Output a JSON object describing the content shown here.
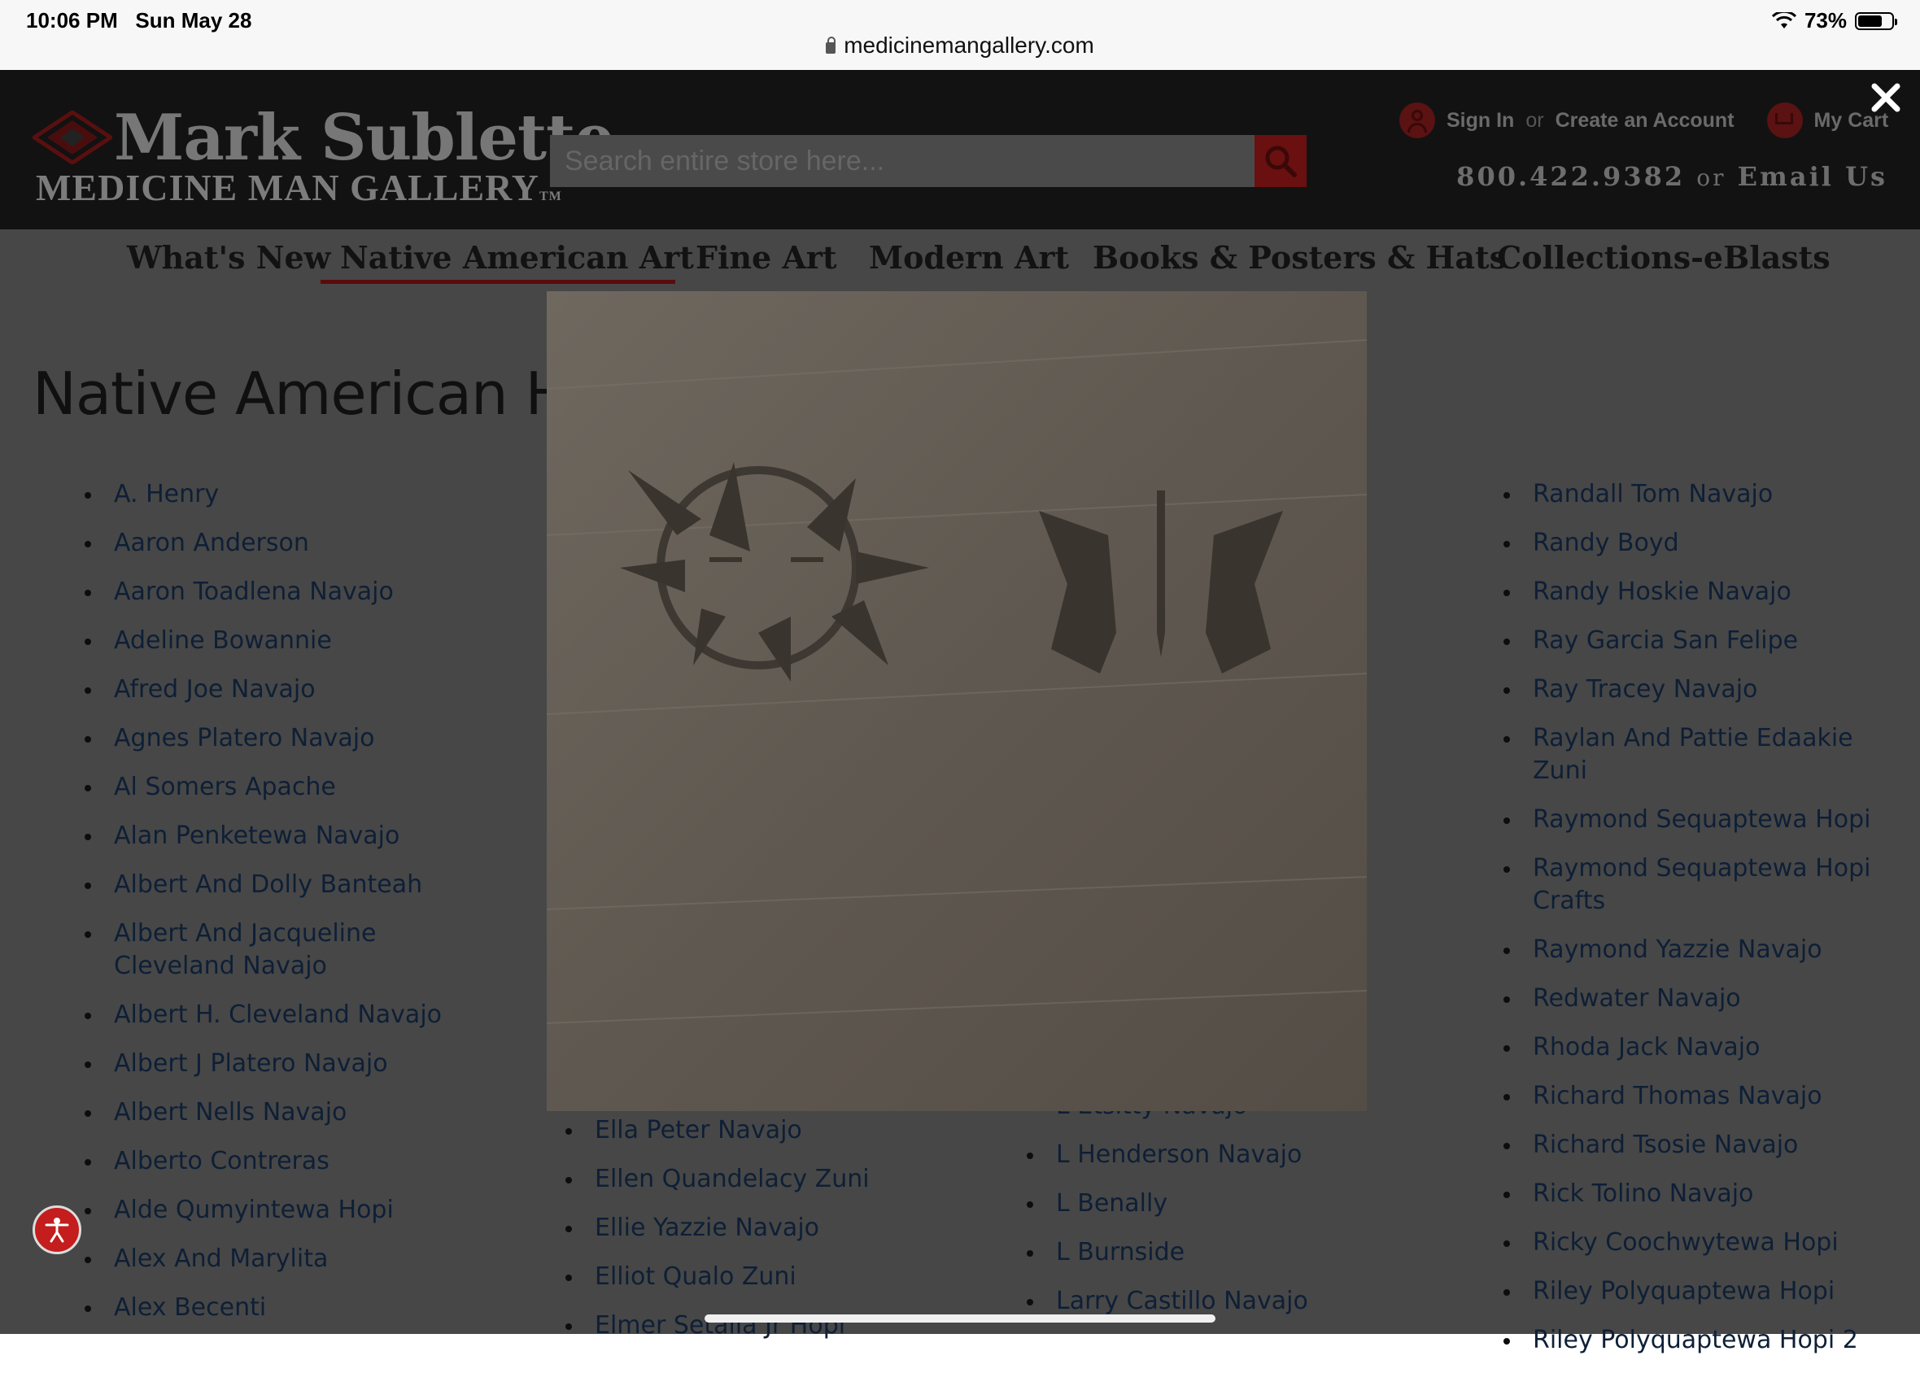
{
  "status_bar": {
    "time": "10:06 PM",
    "date": "Sun May 28",
    "battery": "73%",
    "battery_level": 0.73,
    "url": "medicinemangallery.com"
  },
  "header": {
    "logo_line1": "Mark Sublette",
    "logo_line2": "MEDICINE MAN GALLERY",
    "logo_tm": "TM",
    "search_placeholder": "Search entire store here...",
    "sign_in": "Sign In",
    "or": "or",
    "create_account": "Create an Account",
    "my_cart": "My Cart",
    "phone": "800.422.9382",
    "email": "Email Us"
  },
  "nav": {
    "items": [
      "What's New",
      "Native American Art",
      "Fine Art",
      "Modern Art",
      "Books & Posters & Hats",
      "Collections-eBlasts"
    ],
    "active": "Native American Art"
  },
  "page": {
    "title": "Native American Ha",
    "col1": [
      "A. Henry",
      "Aaron Anderson",
      "Aaron Toadlena Navajo",
      "Adeline Bowannie",
      "Afred Joe Navajo",
      "Agnes Platero Navajo",
      "Al Somers Apache",
      "Alan Penketewa Navajo",
      "Albert And Dolly Banteah",
      "Albert And Jacqueline Cleveland Navajo",
      "Albert H. Cleveland Navajo",
      "Albert J Platero Navajo",
      "Albert Nells Navajo",
      "Alberto Contreras",
      "Alde Qumyintewa Hopi",
      "Alex And Marylita",
      "Alex Becenti"
    ],
    "col2": [
      "Ella Peter Navajo",
      "Ellen Quandelacy Zuni",
      "Ellie Yazzie Navajo",
      "Elliot Qualo Zuni",
      "Elmer Setalla Jr Hopi"
    ],
    "col3": [
      "L Etsitty Navajo",
      "L Henderson Navajo",
      "L Benally",
      "L Burnside",
      "Larry Castillo Navajo"
    ],
    "col4": [
      "Randall Tom Navajo",
      "Randy Boyd",
      "Randy Hoskie Navajo",
      "Ray Garcia San Felipe",
      "Ray Tracey Navajo",
      "Raylan And Pattie Edaakie Zuni",
      "Raymond Sequaptewa Hopi",
      "Raymond Sequaptewa Hopi Crafts",
      "Raymond Yazzie Navajo",
      "Redwater Navajo",
      "Rhoda Jack Navajo",
      "Richard Thomas Navajo",
      "Richard Tsosie Navajo",
      "Rick Tolino Navajo",
      "Ricky Coochwytewa Hopi",
      "Riley Polyquaptewa Hopi",
      "Riley Polyquaptewa Hopi 2"
    ]
  },
  "lightbox": {
    "image_alt": "Hallmark stamp: sun and butterfly"
  },
  "colors": {
    "header_bg": "#121212",
    "accent_red": "#6a1010",
    "link_blue": "#0e1f36",
    "overlay_bg": "#474747"
  }
}
